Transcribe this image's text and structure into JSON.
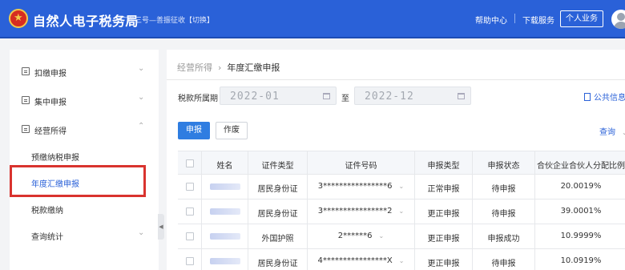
{
  "header": {
    "title": "自然人电子税务局",
    "region": "广东三号—善振征收【切换】",
    "help": "帮助中心",
    "download": "下载服务",
    "personal": "个人业务"
  },
  "sidebar": {
    "items": [
      {
        "label": "扣缴申报",
        "icon": "report-icon"
      },
      {
        "label": "集中申报",
        "icon": "profile-icon"
      },
      {
        "label": "经营所得",
        "icon": "shield-icon"
      }
    ],
    "subitems": [
      {
        "label": "预缴纳税申报"
      },
      {
        "label": "年度汇缴申报",
        "active": true
      },
      {
        "label": "税款缴纳"
      },
      {
        "label": "查询统计"
      }
    ]
  },
  "breadcrumb": {
    "parent": "经营所得",
    "current": "年度汇缴申报"
  },
  "filters": {
    "period_label": "税款所属期",
    "start": "2022-01",
    "to": "至",
    "end": "2022-12",
    "public_info": "公共信息"
  },
  "actions": {
    "declare": "申报",
    "void": "作废",
    "query": "查询"
  },
  "table": {
    "columns": [
      "姓名",
      "证件类型",
      "证件号码",
      "申报类型",
      "申报状态",
      "合伙企业合伙人分配比例"
    ],
    "rows": [
      {
        "id_type": "居民身份证",
        "id_no": "3****************6",
        "declare_type": "正常申报",
        "status": "待申报",
        "ratio": "20.0019%"
      },
      {
        "id_type": "居民身份证",
        "id_no": "3****************2",
        "declare_type": "更正申报",
        "status": "待申报",
        "ratio": "39.0001%"
      },
      {
        "id_type": "外国护照",
        "id_no": "2******6",
        "declare_type": "更正申报",
        "status": "申报成功",
        "ratio": "10.9999%"
      },
      {
        "id_type": "居民身份证",
        "id_no": "4****************X",
        "declare_type": "更正申报",
        "status": "待申报",
        "ratio": "10.0919%"
      }
    ]
  },
  "colors": {
    "header_bg": "#2a61d8",
    "primary": "#2f7de1",
    "highlight": "#d9332e"
  }
}
